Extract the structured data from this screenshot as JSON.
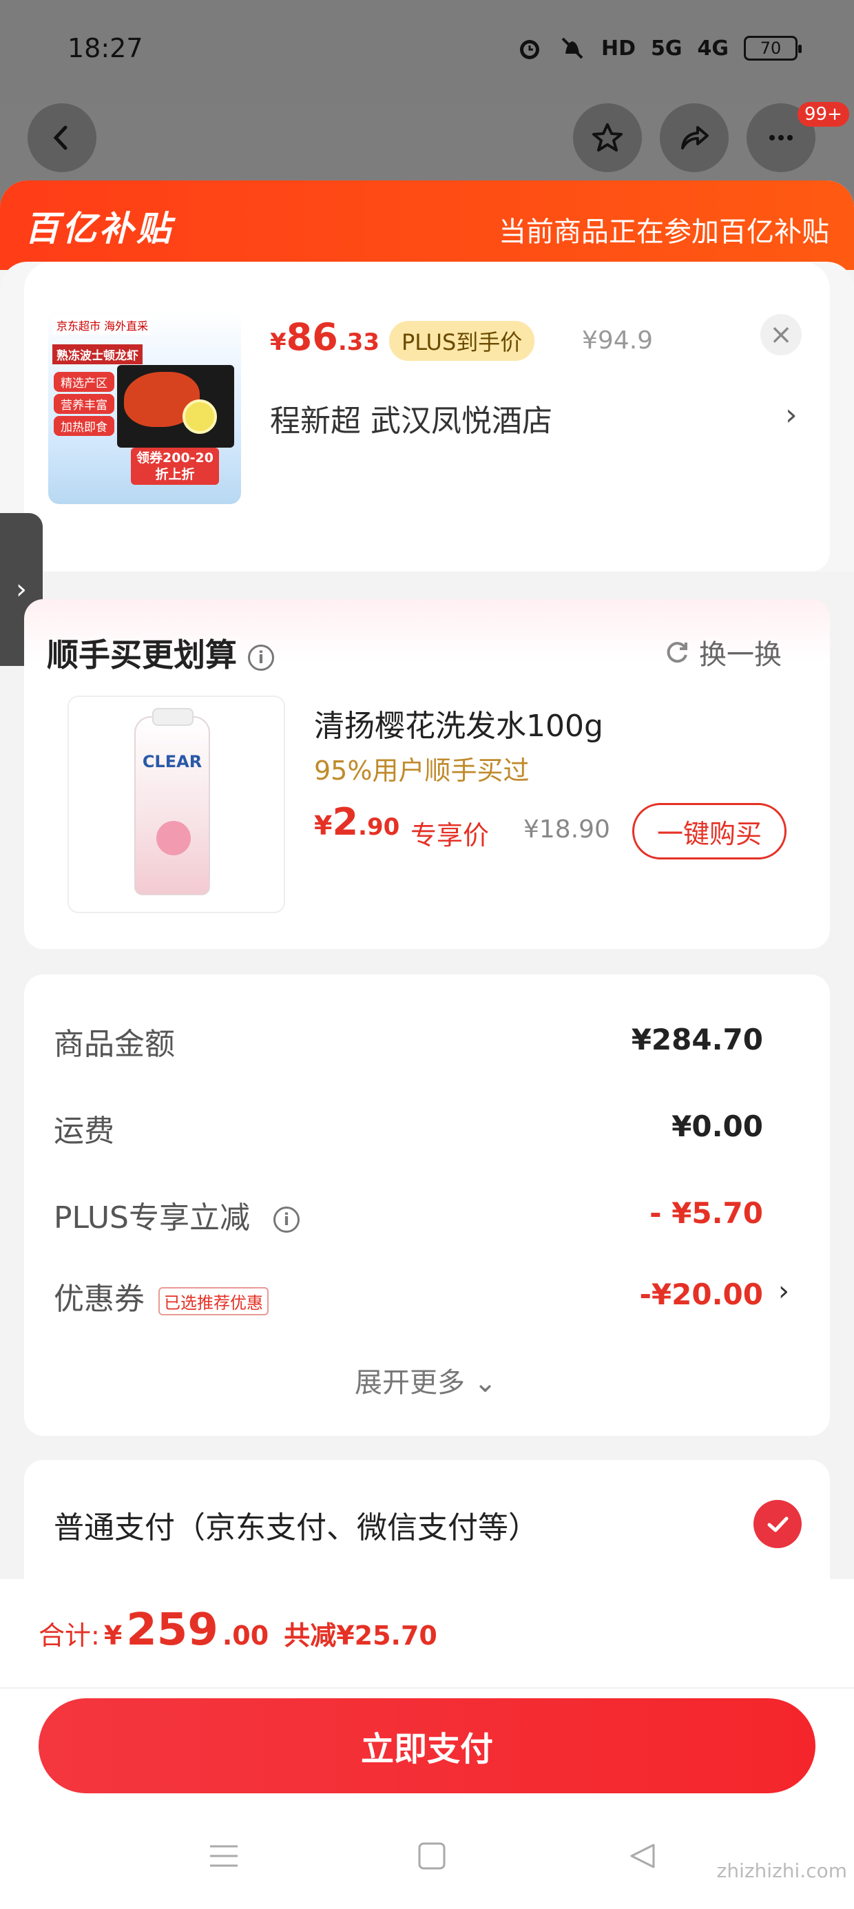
{
  "status": {
    "time": "18:27",
    "battery": "70",
    "net1": "HD",
    "net2": "5G",
    "net3": "4G"
  },
  "nav": {
    "badge": "99+"
  },
  "banner": {
    "logo": "百亿补贴",
    "text": "当前商品正在参加百亿补贴"
  },
  "product": {
    "price_yen": "¥",
    "price_int": "86",
    "price_dec": ".33",
    "plus_label": "PLUS到手价",
    "orig_price": "¥94.9",
    "store": "程新超  武汉凤悦酒店",
    "img": {
      "tag": "京东超市 海外直采",
      "headline": "熟冻波士顿龙虾",
      "pill1": "精选产区",
      "pill2": "营养丰富",
      "pill3": "加热即食",
      "coupon1": "领券200-20",
      "coupon2": "折上折"
    }
  },
  "upsell": {
    "title": "顺手买更划算",
    "swap": "换一换",
    "name": "清扬樱花洗发水100g",
    "sub": "95%用户顺手买过",
    "price_yen": "¥",
    "price_int": "2",
    "price_dec": ".90",
    "tag": "专享价",
    "orig": "¥18.90",
    "buy": "一键购买",
    "bottle_brand": "CLEAR"
  },
  "summary": {
    "rows": [
      {
        "label": "商品金额",
        "value": "¥284.70"
      },
      {
        "label": "运费",
        "value": "¥0.00"
      },
      {
        "label": "PLUS专享立减",
        "value": "- ¥5.70"
      },
      {
        "label": "优惠券",
        "value": "-¥20.00",
        "tag": "已选推荐优惠"
      }
    ],
    "expand": "展开更多"
  },
  "payment": {
    "label": "普通支付（京东支付、微信支付等）"
  },
  "footer": {
    "total_label": "合计:",
    "total_yen": "¥",
    "total_int": "259",
    "total_dec": ".00",
    "saved": "共减¥25.70",
    "pay_button": "立即支付"
  },
  "watermark": "zhizhizhi.com"
}
